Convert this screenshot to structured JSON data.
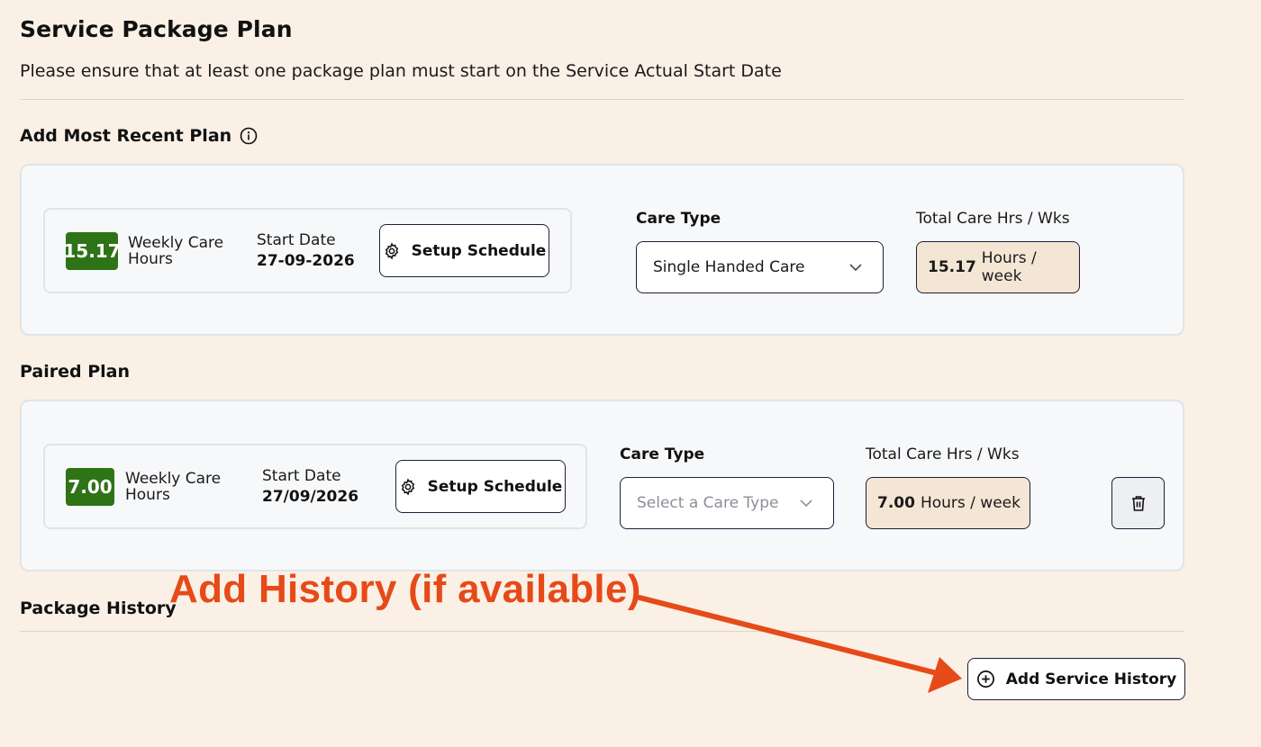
{
  "header": {
    "title": "Service Package Plan",
    "subtitle": "Please ensure that at least one package plan must start on the Service Actual Start Date"
  },
  "most_recent_plan": {
    "section_title": "Add Most Recent Plan",
    "info_icon": "info-circle-icon",
    "weekly_hours": "15.17",
    "weekly_hours_label": "Weekly Care Hours",
    "start_date_label": "Start Date",
    "start_date": "27-09-2026",
    "setup_schedule_label": "Setup Schedule",
    "care_type_label": "Care Type",
    "care_type_value": "Single Handed Care",
    "total_label": "Total Care Hrs / Wks",
    "total_hours": "15.17",
    "total_unit": "Hours / week"
  },
  "paired_plan": {
    "section_title": "Paired Plan",
    "weekly_hours": "7.00",
    "weekly_hours_label": "Weekly Care Hours",
    "start_date_label": "Start Date",
    "start_date": "27/09/2026",
    "setup_schedule_label": "Setup Schedule",
    "care_type_label": "Care Type",
    "care_type_placeholder": "Select a Care Type",
    "total_label": "Total Care Hrs / Wks",
    "total_hours": "7.00",
    "total_unit": "Hours / week",
    "delete_icon": "trash-icon"
  },
  "package_history": {
    "section_title": "Package History",
    "add_button_label": "Add Service History",
    "add_icon": "plus-circle-icon"
  },
  "annotation": {
    "text": "Add History (if available)",
    "color": "#e64a19"
  },
  "colors": {
    "background": "#faf0e6",
    "badge_green": "#2e7316",
    "hours_box_bg": "#f4e6d4",
    "border_dark": "#1c1f3a"
  }
}
